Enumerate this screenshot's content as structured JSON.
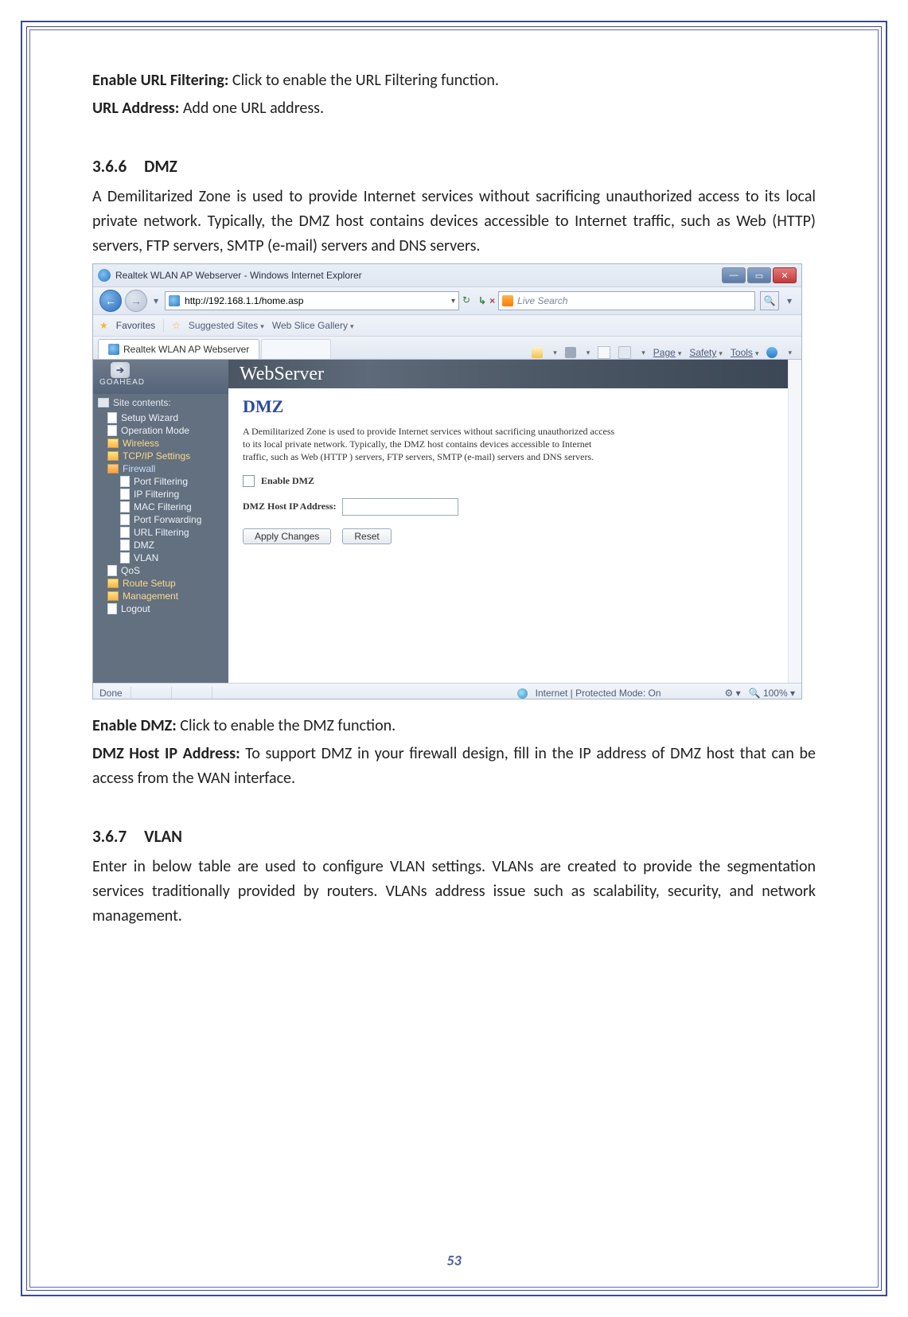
{
  "page_number": "53",
  "intro": {
    "enable_url_filtering_label": "Enable URL Filtering:",
    "enable_url_filtering_text": " Click to enable the URL Filtering function.",
    "url_address_label": "URL Address:",
    "url_address_text": " Add one URL address."
  },
  "section_366": {
    "number": "3.6.6",
    "title": "DMZ",
    "paragraph": "A Demilitarized Zone is used to provide Internet services without sacrificing unauthorized access to its local private network. Typically, the DMZ host contains devices accessible to Internet traffic, such as Web (HTTP) servers, FTP servers, SMTP (e-mail) servers and DNS servers."
  },
  "screenshot": {
    "window_title": "Realtek WLAN AP Webserver - Windows Internet Explorer",
    "url": "http://192.168.1.1/home.asp",
    "search_placeholder": "Live Search",
    "favorites_label": "Favorites",
    "suggested_sites": "Suggested Sites",
    "web_slice_gallery": "Web Slice Gallery",
    "tab_title": "Realtek WLAN AP Webserver",
    "cmd": {
      "page": "Page",
      "safety": "Safety",
      "tools": "Tools"
    },
    "sidebar": {
      "brand": "GOAHEAD",
      "root": "Site contents:",
      "items": [
        "Setup Wizard",
        "Operation Mode",
        "Wireless",
        "TCP/IP Settings",
        "Firewall",
        "Port Filtering",
        "IP Filtering",
        "MAC Filtering",
        "Port Forwarding",
        "URL Filtering",
        "DMZ",
        "VLAN",
        "QoS",
        "Route Setup",
        "Management",
        "Logout"
      ]
    },
    "main": {
      "header": "WebServer",
      "title": "DMZ",
      "desc": "A Demilitarized Zone is used to provide Internet services without sacrificing unauthorized access to its local private network. Typically, the DMZ host contains devices accessible to Internet traffic, such as Web (HTTP ) servers, FTP servers, SMTP (e-mail) servers and DNS servers.",
      "enable_dmz": "Enable DMZ",
      "host_label": "DMZ Host IP Address:",
      "apply": "Apply Changes",
      "reset": "Reset"
    },
    "status": {
      "done": "Done",
      "zone": "Internet | Protected Mode: On",
      "zoom": "100%"
    }
  },
  "after_screenshot": {
    "enable_dmz_label": "Enable DMZ:",
    "enable_dmz_text": " Click to enable the DMZ function.",
    "host_label": "DMZ Host IP Address:",
    "host_text": " To support DMZ in your firewall design, fill in the IP address of DMZ host that can be access from the WAN interface."
  },
  "section_367": {
    "number": "3.6.7",
    "title": "VLAN",
    "paragraph": "Enter in below table are used to configure VLAN settings. VLANs are created to provide the segmentation services traditionally provided by routers. VLANs address issue such as scalability, security, and network management."
  }
}
